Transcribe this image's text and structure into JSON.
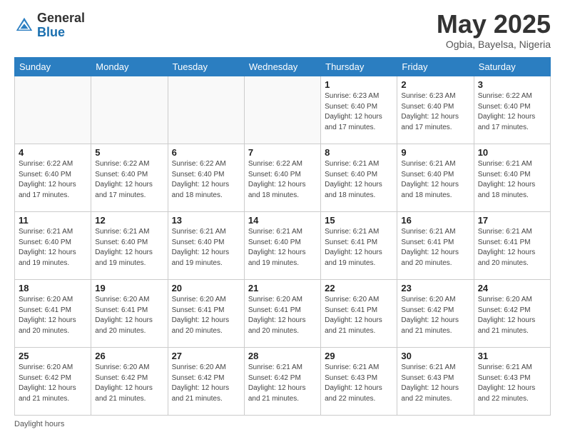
{
  "header": {
    "logo_general": "General",
    "logo_blue": "Blue",
    "month_title": "May 2025",
    "location": "Ogbia, Bayelsa, Nigeria"
  },
  "calendar": {
    "days_of_week": [
      "Sunday",
      "Monday",
      "Tuesday",
      "Wednesday",
      "Thursday",
      "Friday",
      "Saturday"
    ],
    "weeks": [
      [
        {
          "day": "",
          "info": ""
        },
        {
          "day": "",
          "info": ""
        },
        {
          "day": "",
          "info": ""
        },
        {
          "day": "",
          "info": ""
        },
        {
          "day": "1",
          "info": "Sunrise: 6:23 AM\nSunset: 6:40 PM\nDaylight: 12 hours\nand 17 minutes."
        },
        {
          "day": "2",
          "info": "Sunrise: 6:23 AM\nSunset: 6:40 PM\nDaylight: 12 hours\nand 17 minutes."
        },
        {
          "day": "3",
          "info": "Sunrise: 6:22 AM\nSunset: 6:40 PM\nDaylight: 12 hours\nand 17 minutes."
        }
      ],
      [
        {
          "day": "4",
          "info": "Sunrise: 6:22 AM\nSunset: 6:40 PM\nDaylight: 12 hours\nand 17 minutes."
        },
        {
          "day": "5",
          "info": "Sunrise: 6:22 AM\nSunset: 6:40 PM\nDaylight: 12 hours\nand 17 minutes."
        },
        {
          "day": "6",
          "info": "Sunrise: 6:22 AM\nSunset: 6:40 PM\nDaylight: 12 hours\nand 18 minutes."
        },
        {
          "day": "7",
          "info": "Sunrise: 6:22 AM\nSunset: 6:40 PM\nDaylight: 12 hours\nand 18 minutes."
        },
        {
          "day": "8",
          "info": "Sunrise: 6:21 AM\nSunset: 6:40 PM\nDaylight: 12 hours\nand 18 minutes."
        },
        {
          "day": "9",
          "info": "Sunrise: 6:21 AM\nSunset: 6:40 PM\nDaylight: 12 hours\nand 18 minutes."
        },
        {
          "day": "10",
          "info": "Sunrise: 6:21 AM\nSunset: 6:40 PM\nDaylight: 12 hours\nand 18 minutes."
        }
      ],
      [
        {
          "day": "11",
          "info": "Sunrise: 6:21 AM\nSunset: 6:40 PM\nDaylight: 12 hours\nand 19 minutes."
        },
        {
          "day": "12",
          "info": "Sunrise: 6:21 AM\nSunset: 6:40 PM\nDaylight: 12 hours\nand 19 minutes."
        },
        {
          "day": "13",
          "info": "Sunrise: 6:21 AM\nSunset: 6:40 PM\nDaylight: 12 hours\nand 19 minutes."
        },
        {
          "day": "14",
          "info": "Sunrise: 6:21 AM\nSunset: 6:40 PM\nDaylight: 12 hours\nand 19 minutes."
        },
        {
          "day": "15",
          "info": "Sunrise: 6:21 AM\nSunset: 6:41 PM\nDaylight: 12 hours\nand 19 minutes."
        },
        {
          "day": "16",
          "info": "Sunrise: 6:21 AM\nSunset: 6:41 PM\nDaylight: 12 hours\nand 20 minutes."
        },
        {
          "day": "17",
          "info": "Sunrise: 6:21 AM\nSunset: 6:41 PM\nDaylight: 12 hours\nand 20 minutes."
        }
      ],
      [
        {
          "day": "18",
          "info": "Sunrise: 6:20 AM\nSunset: 6:41 PM\nDaylight: 12 hours\nand 20 minutes."
        },
        {
          "day": "19",
          "info": "Sunrise: 6:20 AM\nSunset: 6:41 PM\nDaylight: 12 hours\nand 20 minutes."
        },
        {
          "day": "20",
          "info": "Sunrise: 6:20 AM\nSunset: 6:41 PM\nDaylight: 12 hours\nand 20 minutes."
        },
        {
          "day": "21",
          "info": "Sunrise: 6:20 AM\nSunset: 6:41 PM\nDaylight: 12 hours\nand 20 minutes."
        },
        {
          "day": "22",
          "info": "Sunrise: 6:20 AM\nSunset: 6:41 PM\nDaylight: 12 hours\nand 21 minutes."
        },
        {
          "day": "23",
          "info": "Sunrise: 6:20 AM\nSunset: 6:42 PM\nDaylight: 12 hours\nand 21 minutes."
        },
        {
          "day": "24",
          "info": "Sunrise: 6:20 AM\nSunset: 6:42 PM\nDaylight: 12 hours\nand 21 minutes."
        }
      ],
      [
        {
          "day": "25",
          "info": "Sunrise: 6:20 AM\nSunset: 6:42 PM\nDaylight: 12 hours\nand 21 minutes."
        },
        {
          "day": "26",
          "info": "Sunrise: 6:20 AM\nSunset: 6:42 PM\nDaylight: 12 hours\nand 21 minutes."
        },
        {
          "day": "27",
          "info": "Sunrise: 6:20 AM\nSunset: 6:42 PM\nDaylight: 12 hours\nand 21 minutes."
        },
        {
          "day": "28",
          "info": "Sunrise: 6:21 AM\nSunset: 6:42 PM\nDaylight: 12 hours\nand 21 minutes."
        },
        {
          "day": "29",
          "info": "Sunrise: 6:21 AM\nSunset: 6:43 PM\nDaylight: 12 hours\nand 22 minutes."
        },
        {
          "day": "30",
          "info": "Sunrise: 6:21 AM\nSunset: 6:43 PM\nDaylight: 12 hours\nand 22 minutes."
        },
        {
          "day": "31",
          "info": "Sunrise: 6:21 AM\nSunset: 6:43 PM\nDaylight: 12 hours\nand 22 minutes."
        }
      ]
    ]
  },
  "footer": {
    "note": "Daylight hours"
  }
}
